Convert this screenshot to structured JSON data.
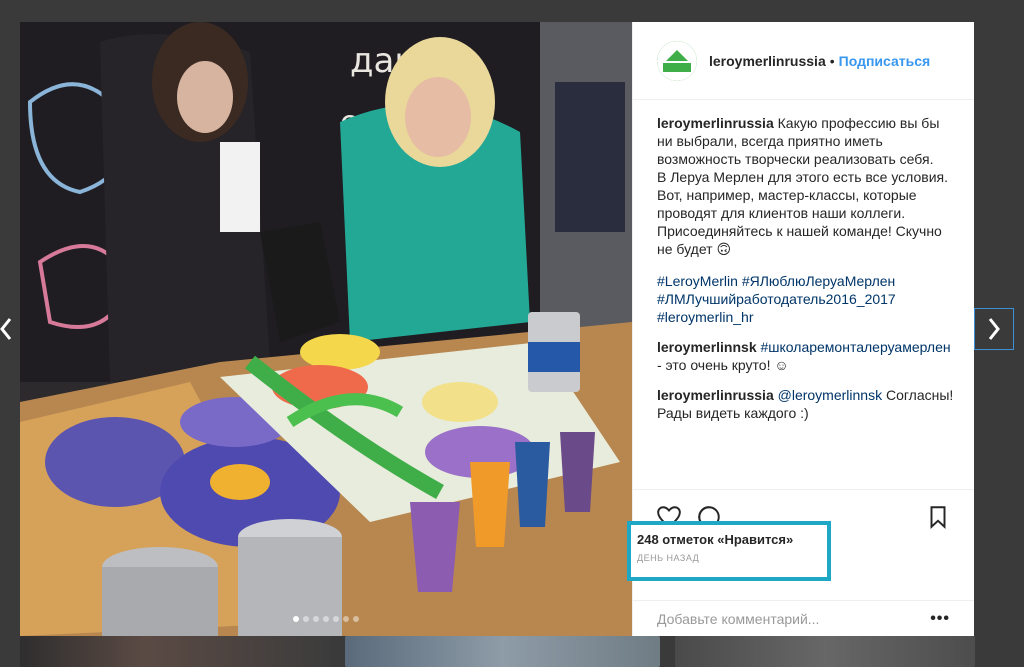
{
  "post": {
    "username": "leroymerlinrussia",
    "follow_label": "Подписаться",
    "separator": "•",
    "caption_user": "leroymerlinrussia",
    "caption_lines": [
      "Какую профессию вы бы",
      "ни выбрали, всегда приятно иметь",
      "возможность творчески реализовать себя.",
      "В Леруа Мерлен для этого есть все условия.",
      "Вот, например, мастер-классы, которые",
      "проводят для клиентов наши коллеги.",
      "Присоединяйтесь к нашей команде! Скучно",
      "не будет 🙃"
    ],
    "hashtags_line1": "#LeroyMerlin #ЯЛюблюЛеруаМерлен",
    "hashtags_line2": "#ЛМЛучшийработодатель2016_2017",
    "hashtags_line3": "#leroymerlin_hr",
    "comments": [
      {
        "user": "leroymerlinnsk",
        "tag": "#школаремонталеруамерлен",
        "text": "- это очень круто! ☺"
      },
      {
        "user": "leroymerlinrussia",
        "tag": "@leroymerlinnsk",
        "text": "Согласны!",
        "text2": "Рады видеть каждого :)"
      }
    ],
    "likes": "248 отметок «Нравится»",
    "time_ago": "ДЕНЬ НАЗАД",
    "comment_placeholder": "Добавьте комментарий...",
    "more_label": "•••"
  },
  "photo": {
    "slide_count": 7,
    "active_slide": 1
  },
  "icons": {
    "avatar": "leroy-merlin-logo",
    "like": "heart-icon",
    "comment": "comment-bubble-icon",
    "save": "bookmark-icon",
    "prev": "chevron-left-icon",
    "next": "chevron-right-icon"
  },
  "colors": {
    "link": "#3897f0",
    "hashtag": "#003569",
    "highlight_box": "#1fa8c6",
    "brand_green": "#3fae49"
  }
}
